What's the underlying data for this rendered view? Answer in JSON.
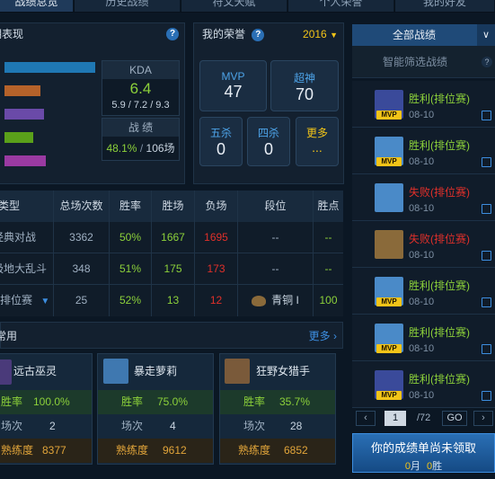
{
  "tabs": [
    "战绩总览",
    "历史战绩",
    "符文天赋",
    "个人荣誉",
    "我的好友"
  ],
  "performance": {
    "title": "近期表现",
    "bars": [
      {
        "color": "#1f78b4",
        "level": 1.0
      },
      {
        "color": "#b5622a",
        "level": 0.4
      },
      {
        "color": "#6a4aa8",
        "level": 0.44
      },
      {
        "color": "#5aa01a",
        "level": 0.32
      },
      {
        "color": "#9a3aa2",
        "level": 0.46
      }
    ],
    "kda_label": "KDA",
    "kda_value": "6.4",
    "kda_detail": "5.9 / 7.2 / 9.3",
    "record_label": "战 绩",
    "winrate": "48.1%",
    "games": "106场"
  },
  "honors": {
    "title": "我的荣誉",
    "year": "2016",
    "items": [
      {
        "label": "MVP",
        "value": "47"
      },
      {
        "label": "超神",
        "value": "70"
      },
      {
        "label": "五杀",
        "value": "0"
      },
      {
        "label": "四杀",
        "value": "0"
      },
      {
        "label": "更多",
        "value": "..."
      }
    ]
  },
  "stats_table": {
    "headers": [
      "类型",
      "总场次数",
      "胜率",
      "胜场",
      "负场",
      "段位",
      "胜点"
    ],
    "rows": [
      {
        "type": "经典对战",
        "total": "3362",
        "winrate": "50%",
        "wins": "1667",
        "losses": "1695",
        "rank": "--",
        "points": "--"
      },
      {
        "type": "极地大乱斗",
        "total": "348",
        "winrate": "51%",
        "wins": "175",
        "losses": "173",
        "rank": "--",
        "points": "--"
      },
      {
        "type": "排位赛",
        "total": "25",
        "winrate": "52%",
        "wins": "13",
        "losses": "12",
        "rank": "青铜 I",
        "points": "100"
      }
    ]
  },
  "recent_champs": {
    "title": "常用",
    "more": "更多",
    "cards": [
      {
        "name": "远古巫灵",
        "winrate_label": "胜率",
        "winrate": "100.0%",
        "games_label": "场次",
        "games": "2",
        "mastery_label": "熟练度",
        "mastery": "8377"
      },
      {
        "name": "暴走萝莉",
        "winrate_label": "胜率",
        "winrate": "75.0%",
        "games_label": "场次",
        "games": "4",
        "mastery_label": "熟练度",
        "mastery": "9612"
      },
      {
        "name": "狂野女猎手",
        "winrate_label": "胜率",
        "winrate": "35.7%",
        "games_label": "场次",
        "games": "28",
        "mastery_label": "熟练度",
        "mastery": "6852"
      }
    ]
  },
  "matches": {
    "filter": "全部战绩",
    "smart_filter": "智能筛选战绩",
    "list": [
      {
        "result": "胜利",
        "mode": "(排位赛)",
        "date": "08-10",
        "mvp": true,
        "win": true,
        "champ": "veigar"
      },
      {
        "result": "胜利",
        "mode": "(排位赛)",
        "date": "08-10",
        "mvp": true,
        "win": true,
        "champ": "jinx"
      },
      {
        "result": "失败",
        "mode": "(排位赛)",
        "date": "08-10",
        "mvp": false,
        "win": false,
        "champ": "jinx"
      },
      {
        "result": "失败",
        "mode": "(排位赛)",
        "date": "08-10",
        "mvp": false,
        "win": false,
        "champ": "nidalee"
      },
      {
        "result": "胜利",
        "mode": "(排位赛)",
        "date": "08-10",
        "mvp": true,
        "win": true,
        "champ": "jinx"
      },
      {
        "result": "胜利",
        "mode": "(排位赛)",
        "date": "08-10",
        "mvp": true,
        "win": true,
        "champ": "jinx"
      },
      {
        "result": "胜利",
        "mode": "(排位赛)",
        "date": "08-10",
        "mvp": true,
        "win": true,
        "champ": "veigar"
      }
    ],
    "mvp_badge": "MVP",
    "pager": {
      "page": "1",
      "total": "/72",
      "go": "GO"
    }
  },
  "banner": {
    "title": "你的成绩单尚未领取",
    "month_value": "0",
    "month_unit": "月",
    "wins_value": "0",
    "wins_unit": "胜"
  },
  "colors": {
    "win": "#8cd13a",
    "loss": "#e0302a",
    "accent": "#3d8ee0",
    "gold": "#f2c418"
  }
}
